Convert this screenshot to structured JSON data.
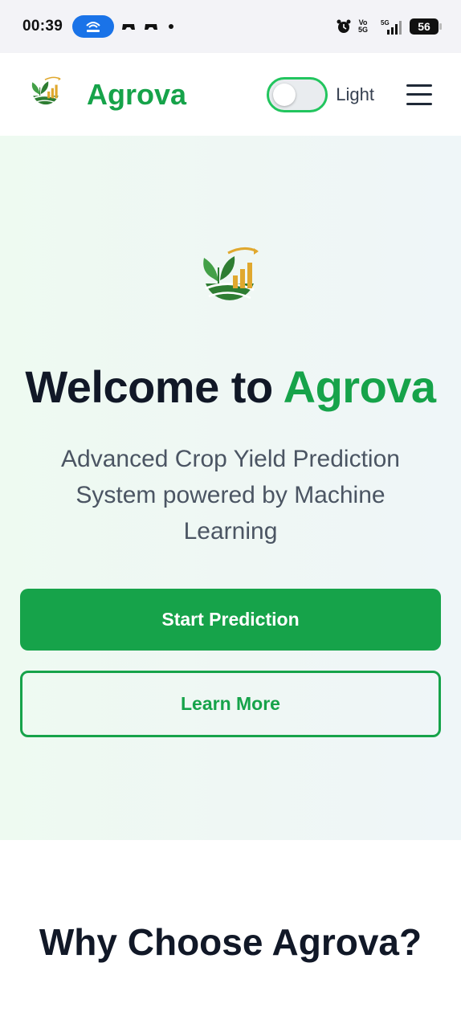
{
  "status_bar": {
    "time": "00:39",
    "battery": "56",
    "network": "5G",
    "volte": [
      "Vo",
      "5G"
    ],
    "icons": [
      "hotspot-icon",
      "game-icon",
      "game-icon",
      "alarm-icon",
      "signal-icon",
      "battery-icon"
    ]
  },
  "navbar": {
    "brand": "Agrova",
    "theme_label": "Light",
    "theme_toggle_on": false,
    "logo_icon": "agrova-logo-icon",
    "menu_icon": "hamburger-menu-icon"
  },
  "hero": {
    "title_prefix": "Welcome to ",
    "title_accent": "Agrova",
    "subtitle": "Advanced Crop Yield Prediction System powered by Machine Learning",
    "primary_button": "Start Prediction",
    "secondary_button": "Learn More"
  },
  "why": {
    "title": "Why Choose Agrova?"
  },
  "colors": {
    "brand_green": "#16a34a",
    "toggle_border": "#22c55e",
    "logo_gold": "#e0a82e",
    "text_dark": "#111827"
  }
}
